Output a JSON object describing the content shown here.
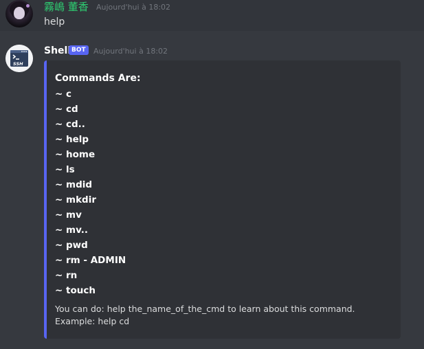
{
  "user_message": {
    "username": "霧嶋 董香",
    "timestamp": "Aujourd'hui à 18:02",
    "text": "help"
  },
  "bot_message": {
    "username": "Shell",
    "tag": "BOT",
    "timestamp": "Aujourd'hui à 18:02",
    "avatar_label": "SSH",
    "embed": {
      "title": "Commands Are:",
      "commands": [
        "~ c",
        "~ cd",
        "~ cd..",
        "~ help",
        "~ home",
        "~ ls",
        "~ mdid",
        "~ mkdir",
        "~ mv",
        "~ mv..",
        "~ pwd",
        "~ rm - ADMIN",
        "~ rn",
        "~ touch"
      ],
      "footer": "You can do: help the_name_of_the_cmd to learn about this command. Example: help cd"
    }
  },
  "colors": {
    "background": "#36393f",
    "embed_background": "#2f3136",
    "embed_accent": "#5865f2",
    "user_name": "#2ecc71",
    "bot_tag": "#5865f2",
    "timestamp": "#72767d"
  }
}
